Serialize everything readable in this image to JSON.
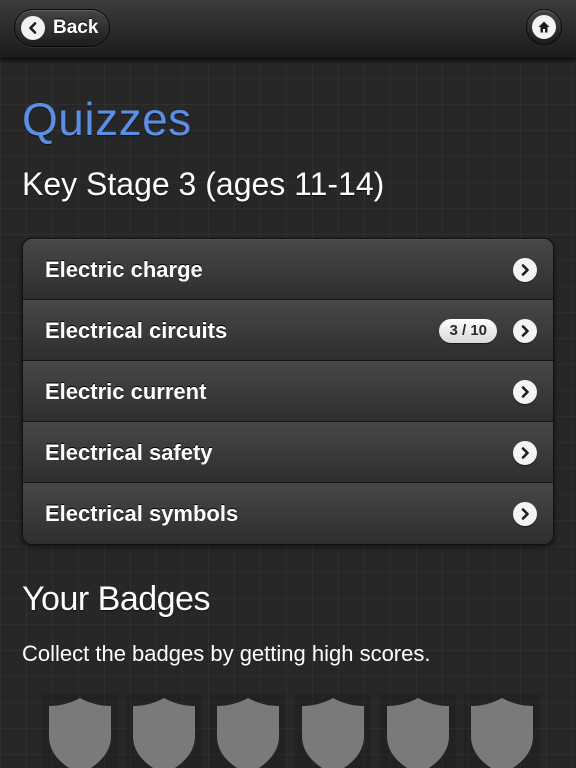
{
  "navbar": {
    "back_label": "Back",
    "back_icon": "chevron-left-icon",
    "home_icon": "home-icon"
  },
  "page": {
    "title": "Quizzes",
    "subtitle": "Key Stage 3 (ages 11-14)"
  },
  "quizzes": [
    {
      "label": "Electric charge",
      "progress": null
    },
    {
      "label": "Electrical circuits",
      "progress": "3 / 10"
    },
    {
      "label": "Electric current",
      "progress": null
    },
    {
      "label": "Electrical safety",
      "progress": null
    },
    {
      "label": "Electrical symbols",
      "progress": null
    }
  ],
  "badges": {
    "title": "Your Badges",
    "description": "Collect the badges by getting high scores.",
    "icon": "shield-badge-icon",
    "count_visible": 6
  },
  "colors": {
    "title_accent": "#5b8fe6",
    "background": "#272727",
    "badge_placeholder": "#7a7a7a"
  }
}
